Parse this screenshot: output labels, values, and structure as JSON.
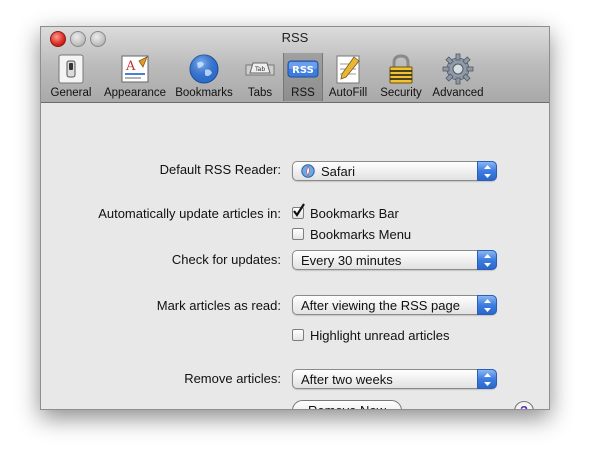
{
  "window": {
    "title": "RSS"
  },
  "toolbar": {
    "items": [
      {
        "label": "General",
        "icon": "switch-icon"
      },
      {
        "label": "Appearance",
        "icon": "appearance-icon"
      },
      {
        "label": "Bookmarks",
        "icon": "globe-icon"
      },
      {
        "label": "Tabs",
        "icon": "tab-icon",
        "icon_text": "Tab"
      },
      {
        "label": "RSS",
        "icon": "rss-icon",
        "icon_text": "RSS",
        "selected": true
      },
      {
        "label": "AutoFill",
        "icon": "autofill-icon"
      },
      {
        "label": "Security",
        "icon": "lock-icon"
      },
      {
        "label": "Advanced",
        "icon": "gear-icon"
      }
    ]
  },
  "form": {
    "default_reader_label": "Default RSS Reader:",
    "default_reader_value": "Safari",
    "auto_update_label": "Automatically update articles in:",
    "bookmarks_bar_label": "Bookmarks Bar",
    "bookmarks_bar_checked": true,
    "bookmarks_menu_label": "Bookmarks Menu",
    "bookmarks_menu_checked": false,
    "check_updates_label": "Check for updates:",
    "check_updates_value": "Every 30 minutes",
    "mark_read_label": "Mark articles as read:",
    "mark_read_value": "After viewing the RSS page",
    "highlight_unread_label": "Highlight unread articles",
    "highlight_unread_checked": false,
    "remove_articles_label": "Remove articles:",
    "remove_articles_value": "After two weeks",
    "remove_now_label": "Remove Now",
    "help_label": "?"
  },
  "colors": {
    "accent": "#3d7de0",
    "selected_tab_bg": "#8e8e8e",
    "window_bg": "#e8e8e8"
  }
}
